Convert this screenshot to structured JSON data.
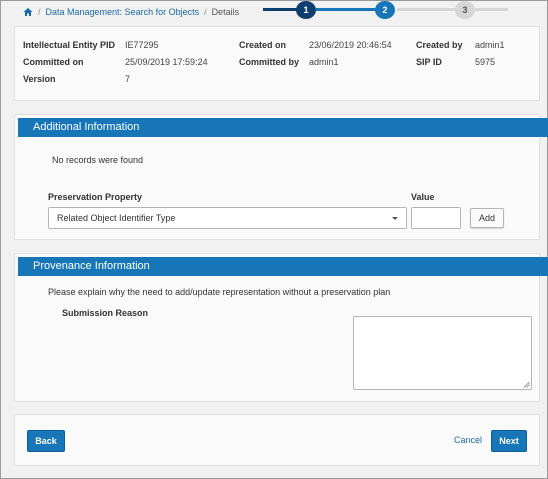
{
  "breadcrumb": {
    "home_icon": "home-icon",
    "items": [
      "Data Management: Search for Objects",
      "Details"
    ],
    "separator": "/"
  },
  "stepper": {
    "steps": [
      "1",
      "2",
      "3"
    ],
    "current_step": 2,
    "colors": {
      "done": "#0e3f6e",
      "active": "#1776b8",
      "pending": "#d6d6d6"
    }
  },
  "entity": {
    "pid_label": "Intellectual Entity PID",
    "pid_value": "IE77295",
    "committed_on_label": "Committed on",
    "committed_on_value": "25/09/2019 17:59:24",
    "version_label": "Version",
    "version_value": "7",
    "created_on_label": "Created on",
    "created_on_value": "23/06/2019 20:46:54",
    "committed_by_label": "Committed by",
    "committed_by_value": "admin1",
    "created_by_label": "Created by",
    "created_by_value": "admin1",
    "sip_label": "SIP ID",
    "sip_value": "5975"
  },
  "additional": {
    "title": "Additional Information",
    "no_records": "No records were found",
    "property_label": "Preservation Property",
    "value_label": "Value",
    "selected_property": "Related Object Identifier Type",
    "value": "",
    "add_label": "Add"
  },
  "provenance": {
    "title": "Provenance Information",
    "instructions": "Please explain why the need to add/update representation without a preservation plan",
    "reason_label": "Submission Reason",
    "reason_value": ""
  },
  "footer": {
    "back_label": "Back",
    "cancel_label": "Cancel",
    "next_label": "Next"
  },
  "colors": {
    "accent": "#1776b8",
    "link": "#1b6aa5"
  }
}
